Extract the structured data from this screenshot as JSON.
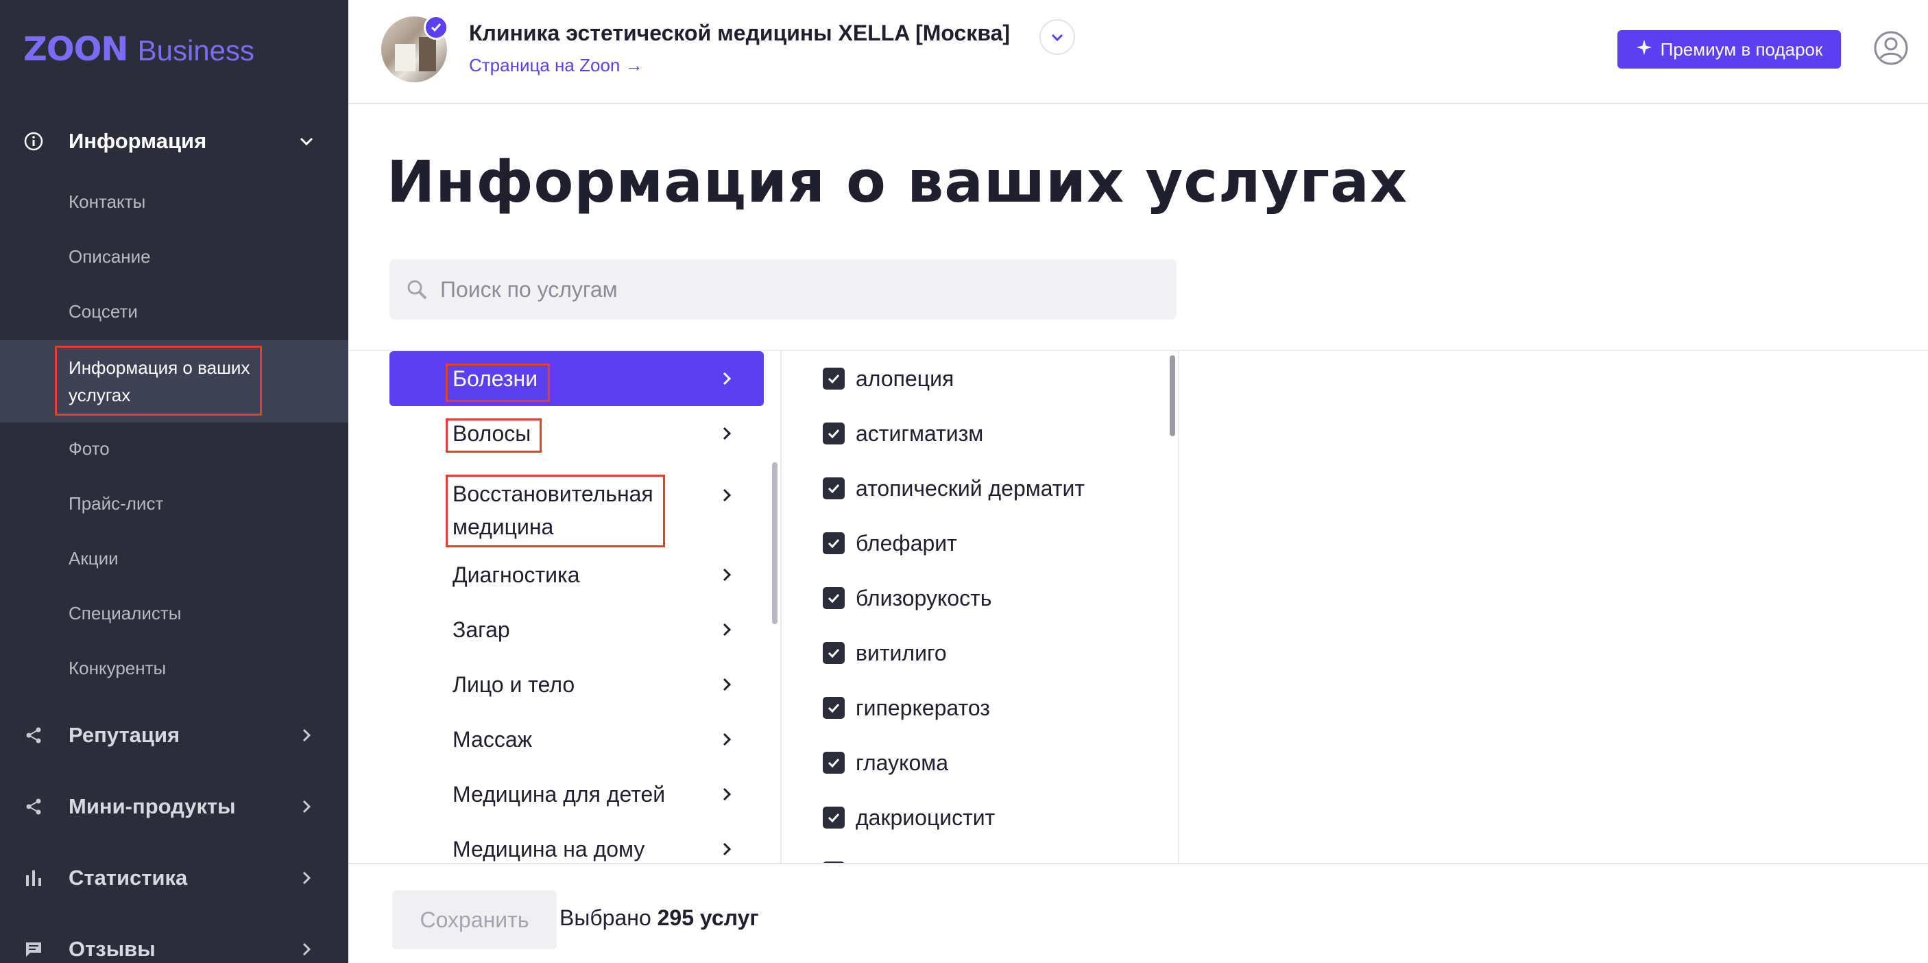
{
  "brand": {
    "logo_main": "ZOON",
    "logo_sub": "Business"
  },
  "sidebar": {
    "section_info": "Информация",
    "items": [
      {
        "label": "Контакты"
      },
      {
        "label": "Описание"
      },
      {
        "label": "Соцсети"
      },
      {
        "label": "Информация о ваших услугах"
      },
      {
        "label": "Фото"
      },
      {
        "label": "Прайс-лист"
      },
      {
        "label": "Акции"
      },
      {
        "label": "Специалисты"
      },
      {
        "label": "Конкуренты"
      }
    ],
    "section_reputation": "Репутация",
    "section_mini": "Мини-продукты",
    "section_stats": "Статистика",
    "section_reviews": "Отзывы"
  },
  "header": {
    "org_title": "Клиника эстетической медицины XELLA [Москва]",
    "org_link": "Страница на Zoon →",
    "premium_label": "Премиум в подарок"
  },
  "main": {
    "title": "Информация о ваших услугах",
    "search_placeholder": "Поиск по услугам"
  },
  "categories": [
    "Болезни",
    "Волосы",
    "Восстановительная медицина",
    "Диагностика",
    "Загар",
    "Лицо и тело",
    "Массаж",
    "Медицина для детей",
    "Медицина на дому"
  ],
  "services": [
    "алопеция",
    "астигматизм",
    "атопический дерматит",
    "блефарит",
    "близорукость",
    "витилиго",
    "гиперкератоз",
    "глаукома",
    "дакриоцистит"
  ],
  "footer": {
    "save_label": "Сохранить",
    "selected_prefix": "Выбрано",
    "selected_count": "295 услуг"
  },
  "colors": {
    "accent": "#5b3ff0",
    "sidebar_bg": "#2b2d3b",
    "highlight": "#e0412a"
  }
}
